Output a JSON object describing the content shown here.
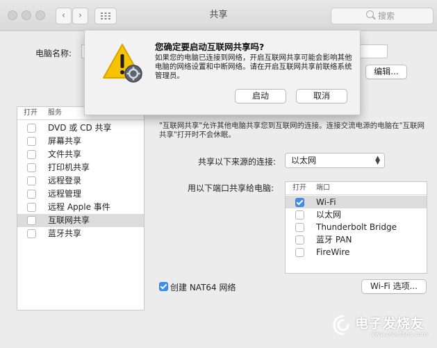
{
  "window": {
    "title": "共享",
    "nav_back": "‹",
    "nav_forward": "›",
    "grid_icon": "grid-icon",
    "search_placeholder": "搜索"
  },
  "computer": {
    "name_label": "电脑名称:",
    "edit_button": "编辑..."
  },
  "alert": {
    "title": "您确定要启动互联网共享吗?",
    "message": "如果您的电脑已连接到网络，开启互联网共享可能会影响其他电脑的网络设置和中断网络。请在开启互联网共享前联络系统管理员。",
    "confirm": "启动",
    "cancel": "取消"
  },
  "services": {
    "col_on": "打开",
    "col_service": "服务",
    "items": [
      {
        "label": "DVD 或 CD 共享",
        "checked": false,
        "selected": false
      },
      {
        "label": "屏幕共享",
        "checked": false,
        "selected": false
      },
      {
        "label": "文件共享",
        "checked": false,
        "selected": false
      },
      {
        "label": "打印机共享",
        "checked": false,
        "selected": false
      },
      {
        "label": "远程登录",
        "checked": false,
        "selected": false
      },
      {
        "label": "远程管理",
        "checked": false,
        "selected": false
      },
      {
        "label": "远程 Apple 事件",
        "checked": false,
        "selected": false
      },
      {
        "label": "互联网共享",
        "checked": false,
        "selected": true
      },
      {
        "label": "蓝牙共享",
        "checked": false,
        "selected": false
      }
    ]
  },
  "detail": {
    "description": "\"互联网共享\"允许其他电脑共享您到互联网的连接。连接交流电源的电脑在\"互联网共享\"打开时不会休眠。",
    "source_label": "共享以下来源的连接:",
    "source_value": "以太网",
    "ports_label": "用以下端口共享给电脑:",
    "ports_col_on": "打开",
    "ports_col_port": "端口",
    "ports": [
      {
        "label": "Wi-Fi",
        "checked": true,
        "selected": true
      },
      {
        "label": "以太网",
        "checked": false,
        "selected": false
      },
      {
        "label": "Thunderbolt Bridge",
        "checked": false,
        "selected": false
      },
      {
        "label": "蓝牙 PAN",
        "checked": false,
        "selected": false
      },
      {
        "label": "FireWire",
        "checked": false,
        "selected": false
      }
    ],
    "nat64_label": "创建 NAT64 网络",
    "nat64_checked": true,
    "wifi_options_button": "Wi-Fi 选项..."
  },
  "watermark": {
    "brand": "电子发烧友",
    "url": "www.elecfans.com"
  }
}
